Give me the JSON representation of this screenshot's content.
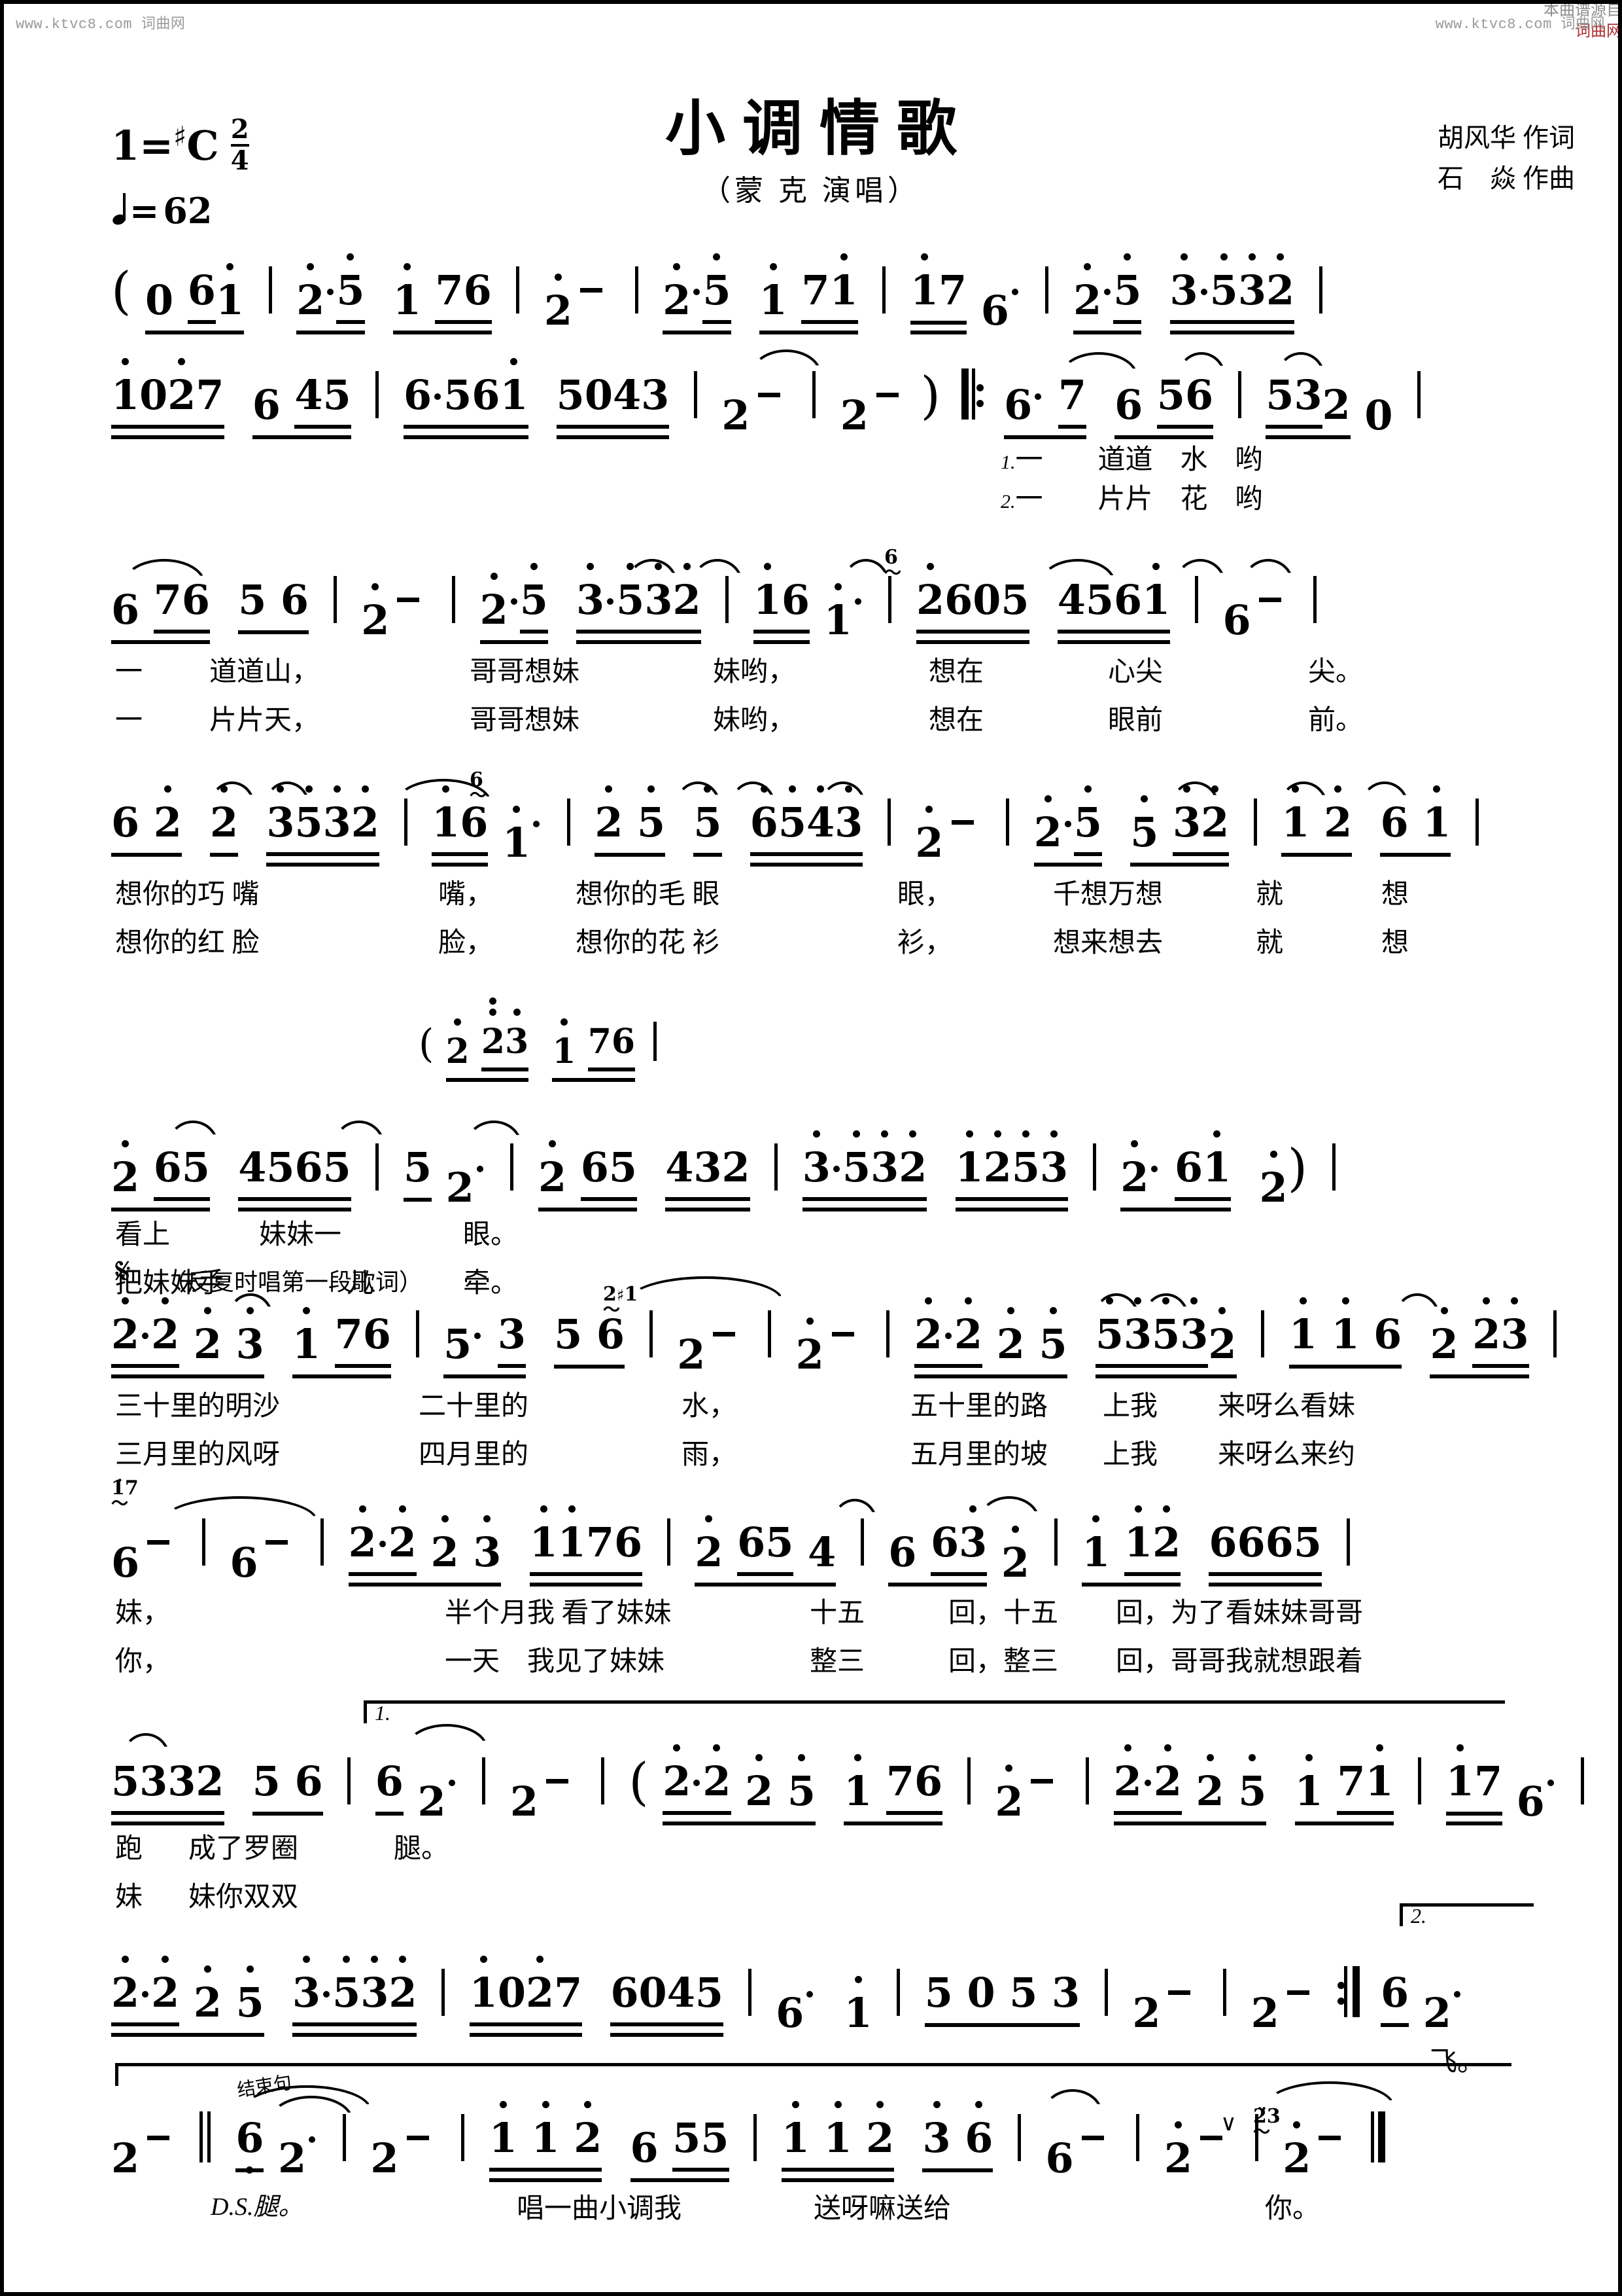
{
  "watermarks": {
    "top_left": "www.ktvc8.com 词曲网",
    "top_right": "www.ktvc8.com  词曲网",
    "bottom_right_line1": "本曲谱源自",
    "bottom_right_line2": "词曲网"
  },
  "header": {
    "title": "小调情歌",
    "subtitle": "（蒙 克 演唱）",
    "lyricist": "胡风华 作词",
    "composer": "石　焱 作曲",
    "key_label": "1=",
    "key_accidental": "♯",
    "key_note": "C",
    "time_numerator": "2",
    "time_denominator": "4",
    "tempo_label": "=",
    "tempo_value": "62"
  },
  "markings": {
    "segno_glyph": "𝄋",
    "segno_note": "（反复时唱第一段歌词）",
    "ds_mark": "D.S.腿。",
    "ending_label": "结束句",
    "ending_1": "1.",
    "ending_2": "2.",
    "verse_1_num": "1.",
    "verse_2_num": "2.",
    "breath_mark": "∨"
  },
  "chart_data": {
    "type": "table",
    "title": "小调情歌 — 简谱",
    "notation": "jianpu",
    "systems": [
      {
        "id": "system-1",
        "measures": [
          "( 0 6 1̇",
          "2̇· 5̇ 1̇ 7 6",
          "2̇ -",
          "2̇· 5̇ 1̇ 7 1̇",
          "1̇ 7 6·",
          "2̇· 5̇ 3·5 3 2"
        ],
        "lyrics_1": "",
        "lyrics_2": ""
      },
      {
        "id": "system-2",
        "measures": [
          "1̇ 0 2̇ 7 6 4 5",
          "6·5 6 1̇ 5 0 4 3",
          "2 -",
          "2 - )",
          "‖: 6· 7 6 5 6",
          "5 3 2 0"
        ],
        "lyrics_1": "1.一　道道　水　哟",
        "lyrics_2": "2.一　片片　花　哟"
      },
      {
        "id": "system-3",
        "measures": [
          "6 7 6 5 6",
          "2̇ -",
          "2̇· 5̇ 3·5 3 2",
          "1̇ 6 (6) 1̇·",
          "2̇ 6 0 5 4 5 6 1̇",
          "6 -"
        ],
        "lyrics_1": "一　道道山，　哥哥想妹　妹哟，　想在　心尖　尖。",
        "lyrics_2": "一　片片天，　哥哥想妹　妹哟，　想在　眼前　前。"
      },
      {
        "id": "system-4",
        "measures": [
          "6 2̇ 2̇ 3 5 3 2",
          "1̇ 6 (6) 1̇·",
          "2̇ 5 5 6 5 4 3",
          "2̇ -",
          "2̇· 5̇ 5 3 2",
          "1̇ 2̇ 6 1̇"
        ],
        "lyrics_1": "想你的巧 嘴　嘴，　想你的毛 眼　眼，　千想万想　就　想",
        "lyrics_2": "想你的红 脸　脸，　想你的花 衫　衫，　想来想去　就　想"
      },
      {
        "id": "system-5",
        "ossia": "( 2̇ 2̇3 1̇ 7 6",
        "measures": [
          "2̇ 6 5 4 5 6 5",
          "5 2· ",
          "2̇ 6 5 4 3 2",
          "3·5 3 2 1̇ 2̇ 5 3",
          "2̇· 6 1̇ 2̇ )"
        ],
        "lyrics_1": "看上　妹妹一　眼。",
        "lyrics_2": "把妹妹手　儿　牵。"
      },
      {
        "id": "system-6",
        "measures": [
          "2̇·2̇ 2̇ 3 1̇ 7 6",
          "5· 3 5 6",
          "2 -",
          "2̇ -",
          "2̇·2̇ 2̇ 5 5 3 5 3 2",
          "1̇ 1̇ 6 2̇ 2̇ 3"
        ],
        "lyrics_1": "三十里的明沙　二十里的　水，　五十里的路　上我　来呀么看妹",
        "lyrics_2": "三月里的风呀　四月里的　雨，　五月里的坡　上我　来呀么来约"
      },
      {
        "id": "system-7",
        "measures": [
          "6 -",
          "6 -",
          "2̇·2̇ 2̇ 3 1̇ 1̇ 7 6",
          "2̇ 6 5 4",
          "6 6 3̇ 2̇",
          "1̇ 1̇ 2̇ 6 6 6 5"
        ],
        "lyrics_1": "妹，　半个月我看了妹妹　十五　回，十五　回，为了看妹妹哥哥",
        "lyrics_2": "你，　一天　我见了妹妹　整三　回，整三　回，哥哥我就想跟着"
      },
      {
        "id": "system-8",
        "measures": [
          "5 3 3 2 5 6",
          "6 2·",
          "2 -",
          "( 2̇·2̇ 2̇ 5 1̇ 7 6",
          "2̇ -",
          "2̇·2̇ 2̇ 5 1̇ 7 1̇",
          "1̇ 7 6·"
        ],
        "lyrics_1": "跑　成了罗圈　腿。",
        "lyrics_2": "妹　妹你双双"
      },
      {
        "id": "system-9",
        "measures": [
          "2̇·2̇ 2̇ 5 3·5 3 2",
          "1̇ 0 2̇ 7 6 0 4 5",
          "6·　1̇",
          "5 0 5 3",
          "2 -",
          "2 - :‖",
          "6 2·"
        ],
        "lyrics_1": "",
        "lyrics_2": "飞。"
      },
      {
        "id": "system-10",
        "measures": [
          "2 -",
          "‖ 6 2·",
          "2 -",
          "1̇ 1̇ 2̇ 6 5 5",
          "1̇ 1̇ 2̇ 3 6",
          "6 - ∨",
          "2̇ -",
          "2̇ - ‖"
        ],
        "lyrics_1": "D.S.腿。　唱一曲小调我　送呀嘛送给　　你。",
        "lyrics_2": ""
      }
    ]
  },
  "systems": [
    {
      "row1": "( 0 6 1 | 2· 5 1 76 | 2 - | 2· 5 1 71 | 176· | 2· 5 3·532 |",
      "row2": "1027 645 | 6·561 5043 | 2 - | 2 - ) ‖: 6· 7 6 56 | 5320 |"
    }
  ],
  "lyrics": {
    "line2_v1": "一　　道道　水　哟",
    "line2_v2": "一　　片片　花　哟",
    "line3_v1_a": "一",
    "line3_v1_b": "道道山，",
    "line3_v1_c": "哥哥想妹",
    "line3_v1_d": "妹哟，",
    "line3_v1_e": "想在",
    "line3_v1_f": "心尖",
    "line3_v1_g": "尖。",
    "line3_v2_a": "一",
    "line3_v2_b": "片片天，",
    "line3_v2_c": "哥哥想妹",
    "line3_v2_d": "妹哟，",
    "line3_v2_e": "想在",
    "line3_v2_f": "眼前",
    "line3_v2_g": "前。",
    "line4_v1_a": "想你的巧 嘴",
    "line4_v1_b": "嘴，",
    "line4_v1_c": "想你的毛 眼",
    "line4_v1_d": "眼，",
    "line4_v1_e": "千想万想",
    "line4_v1_f": "就",
    "line4_v1_g": "想",
    "line4_v2_a": "想你的红 脸",
    "line4_v2_b": "脸，",
    "line4_v2_c": "想你的花 衫",
    "line4_v2_d": "衫，",
    "line4_v2_e": "想来想去",
    "line4_v2_f": "就",
    "line4_v2_g": "想",
    "line5_v1_a": "看上",
    "line5_v1_b": "妹妹一",
    "line5_v1_c": "眼。",
    "line5_v2_a": "把妹妹手",
    "line5_v2_b": "儿",
    "line5_v2_c": "牵。",
    "line6_v1_a": "三十里的明沙",
    "line6_v1_b": "二十里的",
    "line6_v1_c": "水，",
    "line6_v1_d": "五十里的路",
    "line6_v1_e": "上我",
    "line6_v1_f": "来呀么看妹",
    "line6_v2_a": "三月里的风呀",
    "line6_v2_b": "四月里的",
    "line6_v2_c": "雨，",
    "line6_v2_d": "五月里的坡",
    "line6_v2_e": "上我",
    "line6_v2_f": "来呀么来约",
    "line7_v1_a": "妹，",
    "line7_v1_b": "半个月我 看了妹妹",
    "line7_v1_c": "十五",
    "line7_v1_d": "回，十五",
    "line7_v1_e": "回，为了看妹妹哥哥",
    "line7_v2_a": "你，",
    "line7_v2_b": "一天　我见了妹妹",
    "line7_v2_c": "整三",
    "line7_v2_d": "回，整三",
    "line7_v2_e": "回，哥哥我就想跟着",
    "line8_v1_a": "跑",
    "line8_v1_b": "成了罗圈",
    "line8_v1_c": "腿。",
    "line8_v2_a": "妹",
    "line8_v2_b": "妹你双双",
    "line9_v2_a": "飞。",
    "line10_a": "唱一曲小调我",
    "line10_b": "送呀嘛送给",
    "line10_c": "你。"
  }
}
